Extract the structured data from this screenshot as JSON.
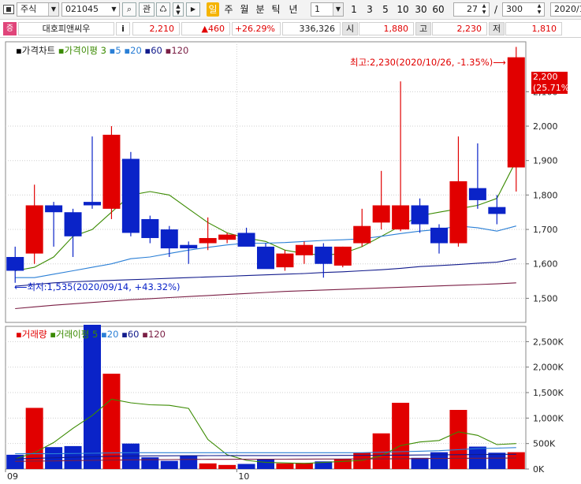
{
  "toolbar": {
    "market": "주식",
    "code": "021045",
    "related": "관",
    "periods": [
      "일",
      "주",
      "월",
      "분",
      "틱",
      "년"
    ],
    "interval_select": "1",
    "intervals": [
      "1",
      "3",
      "5",
      "10",
      "30",
      "60"
    ],
    "count": "27",
    "sep": "/",
    "total": "300",
    "date": "2020/1"
  },
  "info": {
    "badge": "증",
    "name": "대호피앤씨우",
    "i_label": "i",
    "price": "2,210",
    "change": "▲460",
    "change_pct": "+26.29%",
    "volume": "336,326",
    "open_label": "시",
    "open": "1,880",
    "high_label": "고",
    "high": "2,230",
    "low_label": "저",
    "low": "1,810"
  },
  "colors": {
    "up": "#e10000",
    "down": "#0a23c8",
    "ma5": "#3a8a00",
    "ma20": "#2a7fd6",
    "ma60": "#121b8c",
    "ma120": "#7a1e44"
  },
  "price_chart": {
    "legend": {
      "title": "가격차트",
      "ma_label": "가격이평",
      "ma": [
        "3",
        "5",
        "20",
        "60",
        "120"
      ]
    },
    "high_note": "최고:2,230(2020/10/26, -1.35%)",
    "low_note": "최저:1,535(2020/09/14, +43.32%)",
    "current_tag": {
      "price": "2,200",
      "pct": "(25.71%)"
    },
    "y_ticks": [
      {
        "v": 1500,
        "t": "1,500"
      },
      {
        "v": 1600,
        "t": "1,600"
      },
      {
        "v": 1700,
        "t": "1,700"
      },
      {
        "v": 1800,
        "t": "1,800"
      },
      {
        "v": 1900,
        "t": "1,900"
      },
      {
        "v": 2000,
        "t": "2,000"
      },
      {
        "v": 2100,
        "t": "2,100"
      }
    ],
    "y_range": [
      1430,
      2245
    ]
  },
  "volume_chart": {
    "legend": {
      "title": "거래량",
      "ma_label": "거래이평",
      "ma": [
        "5",
        "20",
        "60",
        "120"
      ]
    },
    "y_ticks": [
      {
        "v": 0,
        "t": "0K"
      },
      {
        "v": 500,
        "t": "500K"
      },
      {
        "v": 1000,
        "t": "1,000K"
      },
      {
        "v": 1500,
        "t": "1,500K"
      },
      {
        "v": 2000,
        "t": "2,000K"
      },
      {
        "v": 2500,
        "t": "2,500K"
      }
    ],
    "y_range": [
      0,
      2800
    ],
    "x_labels": [
      {
        "i": 0,
        "t": "09"
      },
      {
        "i": 12,
        "t": "10"
      }
    ]
  },
  "chart_data": [
    {
      "type": "candlestick",
      "title": "가격차트",
      "candles": [
        {
          "o": 1620,
          "h": 1650,
          "l": 1545,
          "c": 1580
        },
        {
          "o": 1630,
          "h": 1830,
          "l": 1600,
          "c": 1770
        },
        {
          "o": 1770,
          "h": 1780,
          "l": 1650,
          "c": 1750
        },
        {
          "o": 1750,
          "h": 1760,
          "l": 1620,
          "c": 1680
        },
        {
          "o": 1780,
          "h": 1970,
          "l": 1760,
          "c": 1770
        },
        {
          "o": 1760,
          "h": 2000,
          "l": 1730,
          "c": 1975
        },
        {
          "o": 1905,
          "h": 1925,
          "l": 1680,
          "c": 1690
        },
        {
          "o": 1730,
          "h": 1740,
          "l": 1660,
          "c": 1675
        },
        {
          "o": 1700,
          "h": 1710,
          "l": 1620,
          "c": 1645
        },
        {
          "o": 1655,
          "h": 1665,
          "l": 1600,
          "c": 1645
        },
        {
          "o": 1660,
          "h": 1735,
          "l": 1640,
          "c": 1675
        },
        {
          "o": 1670,
          "h": 1690,
          "l": 1660,
          "c": 1685
        },
        {
          "o": 1690,
          "h": 1705,
          "l": 1655,
          "c": 1650
        },
        {
          "o": 1650,
          "h": 1660,
          "l": 1600,
          "c": 1585
        },
        {
          "o": 1590,
          "h": 1640,
          "l": 1580,
          "c": 1630
        },
        {
          "o": 1625,
          "h": 1665,
          "l": 1600,
          "c": 1655
        },
        {
          "o": 1650,
          "h": 1660,
          "l": 1560,
          "c": 1600
        },
        {
          "o": 1595,
          "h": 1650,
          "l": 1590,
          "c": 1650
        },
        {
          "o": 1660,
          "h": 1760,
          "l": 1650,
          "c": 1710
        },
        {
          "o": 1720,
          "h": 1870,
          "l": 1700,
          "c": 1770
        },
        {
          "o": 1700,
          "h": 2130,
          "l": 1695,
          "c": 1770
        },
        {
          "o": 1770,
          "h": 1790,
          "l": 1690,
          "c": 1715
        },
        {
          "o": 1705,
          "h": 1715,
          "l": 1630,
          "c": 1660
        },
        {
          "o": 1660,
          "h": 1970,
          "l": 1650,
          "c": 1840
        },
        {
          "o": 1820,
          "h": 1950,
          "l": 1760,
          "c": 1785
        },
        {
          "o": 1765,
          "h": 1800,
          "l": 1715,
          "c": 1745
        },
        {
          "o": 1880,
          "h": 2230,
          "l": 1810,
          "c": 2200
        }
      ],
      "ma_series": [
        {
          "period": "3",
          "values": [
            1580,
            1590,
            1620,
            1680,
            1700,
            1750,
            1800,
            1810,
            1800,
            1760,
            1720,
            1690,
            1675,
            1665,
            1640,
            1630,
            1625,
            1630,
            1650,
            1680,
            1710,
            1740,
            1750,
            1760,
            1770,
            1790,
            1900
          ]
        },
        {
          "period": "20",
          "values": [
            1560,
            1560,
            1570,
            1580,
            1590,
            1600,
            1615,
            1620,
            1630,
            1640,
            1648,
            1655,
            1660,
            1660,
            1662,
            1665,
            1668,
            1670,
            1673,
            1680,
            1688,
            1695,
            1700,
            1710,
            1705,
            1695,
            1710
          ]
        },
        {
          "period": "60",
          "values": [
            1535,
            1540,
            1545,
            1548,
            1550,
            1552,
            1554,
            1556,
            1558,
            1560,
            1562,
            1564,
            1566,
            1568,
            1570,
            1572,
            1575,
            1577,
            1580,
            1583,
            1587,
            1592,
            1595,
            1598,
            1602,
            1605,
            1615
          ]
        },
        {
          "period": "120",
          "values": [
            1470,
            1475,
            1480,
            1484,
            1488,
            1492,
            1496,
            1499,
            1502,
            1505,
            1508,
            1511,
            1514,
            1517,
            1520,
            1522,
            1524,
            1526,
            1528,
            1530,
            1532,
            1534,
            1536,
            1538,
            1540,
            1542,
            1545
          ]
        }
      ]
    },
    {
      "type": "bar",
      "title": "거래량",
      "unit": "K",
      "volume": [
        280,
        1200,
        430,
        450,
        2900,
        1870,
        500,
        230,
        160,
        260,
        110,
        80,
        100,
        190,
        110,
        120,
        150,
        200,
        320,
        700,
        1300,
        220,
        330,
        1160,
        440,
        320,
        330
      ],
      "ma_series": [
        {
          "period": "5",
          "values": [
            200,
            320,
            520,
            800,
            1050,
            1370,
            1300,
            1260,
            1250,
            1190,
            580,
            280,
            170,
            130,
            120,
            110,
            130,
            150,
            170,
            260,
            460,
            530,
            560,
            730,
            660,
            480,
            500
          ]
        },
        {
          "period": "20",
          "values": [
            300,
            300,
            300,
            305,
            310,
            315,
            320,
            320,
            320,
            320,
            320,
            320,
            320,
            320,
            320,
            320,
            320,
            320,
            320,
            330,
            340,
            350,
            360,
            380,
            400,
            410,
            420
          ]
        },
        {
          "period": "60",
          "values": [
            200,
            210,
            220,
            230,
            240,
            250,
            255,
            258,
            260,
            262,
            263,
            264,
            265,
            265,
            265,
            265,
            266,
            267,
            268,
            270,
            272,
            275,
            278,
            282,
            285,
            288,
            290
          ]
        },
        {
          "period": "120",
          "values": [
            150,
            155,
            160,
            165,
            170,
            175,
            180,
            183,
            186,
            189,
            190,
            191,
            192,
            193,
            194,
            195,
            196,
            197,
            198,
            200,
            202,
            205,
            208,
            210,
            212,
            214,
            216
          ]
        }
      ]
    }
  ]
}
